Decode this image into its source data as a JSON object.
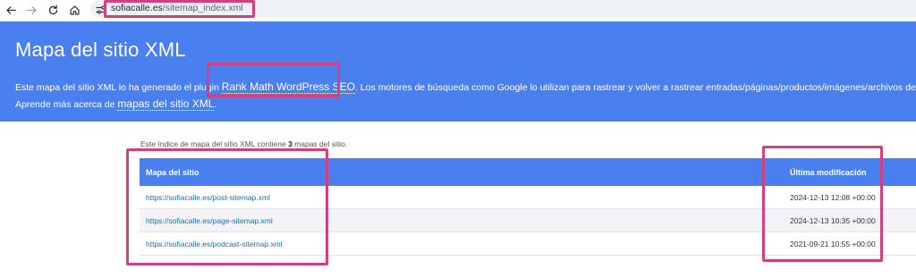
{
  "browser": {
    "url_host": "sofiacalle.es",
    "url_path": "/sitemap_index.xml"
  },
  "header": {
    "title": "Mapa del sitio XML",
    "desc_pre": "Este mapa del sitio XML lo ha generado el plugin ",
    "plugin_link": "Rank Math WordPress SEO",
    "desc_post": ". Los motores de búsqueda como Google lo utilizan para rastrear y volver a rastrear entradas/páginas/productos/imágenes/archivos de tu web.",
    "learn_pre": "Aprende más acerca de ",
    "learn_link": "mapas del sitio XML",
    "learn_post": "."
  },
  "intro": {
    "pre": "Este índice de mapa del sitio XML contiene ",
    "count": "3",
    "post": " mapas del sitio."
  },
  "table": {
    "col_sitemap": "Mapa del sitio",
    "col_modified": "Última modificación",
    "rows": [
      {
        "url": "https://sofiacalle.es/post-sitemap.xml",
        "modified": "2024-12-13 12:08 +00:00"
      },
      {
        "url": "https://sofiacalle.es/page-sitemap.xml",
        "modified": "2024-12-13 10:35 +00:00"
      },
      {
        "url": "https://sofiacalle.es/podcast-sitemap.xml",
        "modified": "2021-09-21 10:55 +00:00"
      }
    ]
  },
  "colors": {
    "accent": "#4a7ff0",
    "highlight": "#d43f7f",
    "link": "#1b6fa8"
  },
  "icons": [
    "back-arrow-icon",
    "forward-arrow-icon",
    "reload-icon",
    "home-icon",
    "site-info-icon"
  ]
}
